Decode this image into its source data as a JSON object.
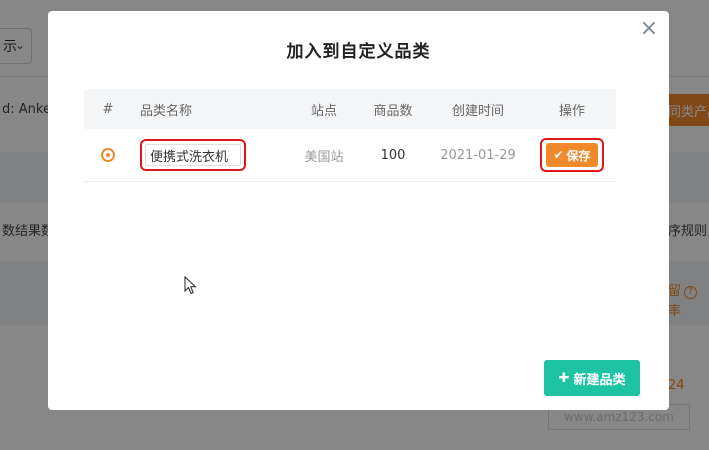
{
  "background": {
    "select_value": "示",
    "filter_label": "d: Anke",
    "orange_button": "同类产品",
    "desc_left": "数结果数",
    "desc_right": "序规则",
    "orange_rate": "留",
    "orange_rate2": "率",
    "orange_num": "24",
    "question_icon": "?"
  },
  "watermark": "www.amz123.com",
  "modal": {
    "title": "加入到自定义品类",
    "close_icon": "×",
    "columns": [
      "#",
      "品类名称",
      "站点",
      "商品数",
      "创建时间",
      "操作"
    ],
    "rows": [
      {
        "name": "便携式洗衣机",
        "site": "美国站",
        "count": "100",
        "created": "2021-01-29",
        "action": "保存"
      }
    ],
    "new_button": "新建品类"
  },
  "colors": {
    "accent": "#f0892b",
    "teal": "#1ec3a4",
    "highlight": "#e0161e"
  }
}
